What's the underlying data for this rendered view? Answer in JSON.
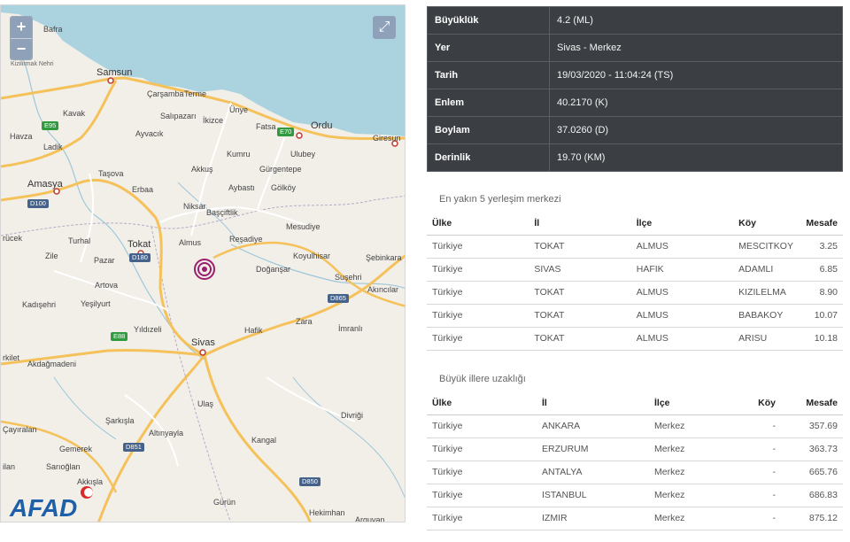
{
  "map": {
    "zoom_in_label": "+",
    "zoom_out_label": "−",
    "fullscreen_icon": "expand-arrows-icon",
    "logo_text": "AFAD",
    "sea_label": "Kizilirmak Nehri",
    "places": {
      "bafra": "Bafra",
      "samsun": "Samsun",
      "carsamba": "Çarşamba",
      "terme": "Terme",
      "unye": "Ünye",
      "fatsa": "Fatsa",
      "ordu": "Ordu",
      "giresun": "Giresun",
      "kavak": "Kavak",
      "havza": "Havza",
      "ladik": "Ladik",
      "salipazari": "Salıpazarı",
      "ikizce": "İkizce",
      "ayvacik": "Ayvacık",
      "kumru": "Kumru",
      "ulubey": "Ulubey",
      "gurgentepe": "Gürgentepe",
      "tasova": "Taşova",
      "akkus": "Akkuş",
      "amasya": "Amasya",
      "erbaa": "Erbaa",
      "aybasti": "Aybastı",
      "golkoy": "Gölköy",
      "niksar": "Niksar",
      "bascifilik": "Başçiftlik",
      "mesudiye": "Mesudiye",
      "corum": "rücek",
      "turhal": "Turhal",
      "tokat": "Tokat",
      "almus": "Almus",
      "resadiye": "Reşadiye",
      "zile": "Zile",
      "pazar": "Pazar",
      "koyulhisar": "Koyulhisar",
      "sebinkarahisar": "Şebinkara",
      "artova": "Artova",
      "dogansar": "Doğanşar",
      "susehri": "Suşehri",
      "akincilar": "Akıncılar",
      "kadisehri": "Kadışehri",
      "yesilyurt": "Yeşilyurt",
      "zara": "Zara",
      "hafik": "Hafik",
      "imranli": "İmranlı",
      "yildizeli": "Yıldızeli",
      "sivas": "Sivas",
      "erkilet": "rkilet",
      "akdagmadeni": "Akdağmadeni",
      "ulas": "Ulaş",
      "divrigi": "Divriği",
      "sarkisla": "Şarkışla",
      "cayiralan": "Çayıralan",
      "altinyayla": "Altınyayla",
      "kangal": "Kangal",
      "gemerek": "Gemerek",
      "ilan": "ilan",
      "sarioglan": "Sarıoğlan",
      "akkisla": "Akkışla",
      "gurun": "Gürün",
      "hekimhan": "Hekimhan",
      "arguvan": "Arguvan"
    },
    "shields": {
      "e95": "E95",
      "e70": "E70",
      "d100": "D100",
      "d180": "D180",
      "d865": "D865",
      "e88": "E88",
      "d851": "D851",
      "d850": "D850"
    }
  },
  "info": {
    "rows": [
      {
        "key": "Büyüklük",
        "value": "4.2 (ML)"
      },
      {
        "key": "Yer",
        "value": "Sivas - Merkez"
      },
      {
        "key": "Tarih",
        "value": "19/03/2020 - 11:04:24 (TS)"
      },
      {
        "key": "Enlem",
        "value": "40.2170 (K)"
      },
      {
        "key": "Boylam",
        "value": "37.0260 (D)"
      },
      {
        "key": "Derinlik",
        "value": "19.70 (KM)"
      }
    ]
  },
  "nearest": {
    "title": "En yakın 5 yerleşim merkezi",
    "headers": [
      "Ülke",
      "İl",
      "İlçe",
      "Köy",
      "Mesafe"
    ],
    "rows": [
      [
        "Türkiye",
        "TOKAT",
        "ALMUS",
        "MESCITKOY",
        "3.25"
      ],
      [
        "Türkiye",
        "SIVAS",
        "HAFIK",
        "ADAMLI",
        "6.85"
      ],
      [
        "Türkiye",
        "TOKAT",
        "ALMUS",
        "KIZILELMA",
        "8.90"
      ],
      [
        "Türkiye",
        "TOKAT",
        "ALMUS",
        "BABAKOY",
        "10.07"
      ],
      [
        "Türkiye",
        "TOKAT",
        "ALMUS",
        "ARISU",
        "10.18"
      ]
    ]
  },
  "cities": {
    "title": "Büyük illere uzaklığı",
    "headers": [
      "Ülke",
      "İl",
      "İlçe",
      "Köy",
      "Mesafe"
    ],
    "rows": [
      [
        "Türkiye",
        "ANKARA",
        "Merkez",
        "-",
        "357.69"
      ],
      [
        "Türkiye",
        "ERZURUM",
        "Merkez",
        "-",
        "363.73"
      ],
      [
        "Türkiye",
        "ANTALYA",
        "Merkez",
        "-",
        "665.76"
      ],
      [
        "Türkiye",
        "ISTANBUL",
        "Merkez",
        "-",
        "686.83"
      ],
      [
        "Türkiye",
        "IZMIR",
        "Merkez",
        "-",
        "875.12"
      ]
    ]
  },
  "colors": {
    "sea": "#aad3df",
    "land": "#f2efe9",
    "highway": "#f5c15a",
    "epicenter": "#9b1d6b",
    "panel": "#3b3f44"
  }
}
